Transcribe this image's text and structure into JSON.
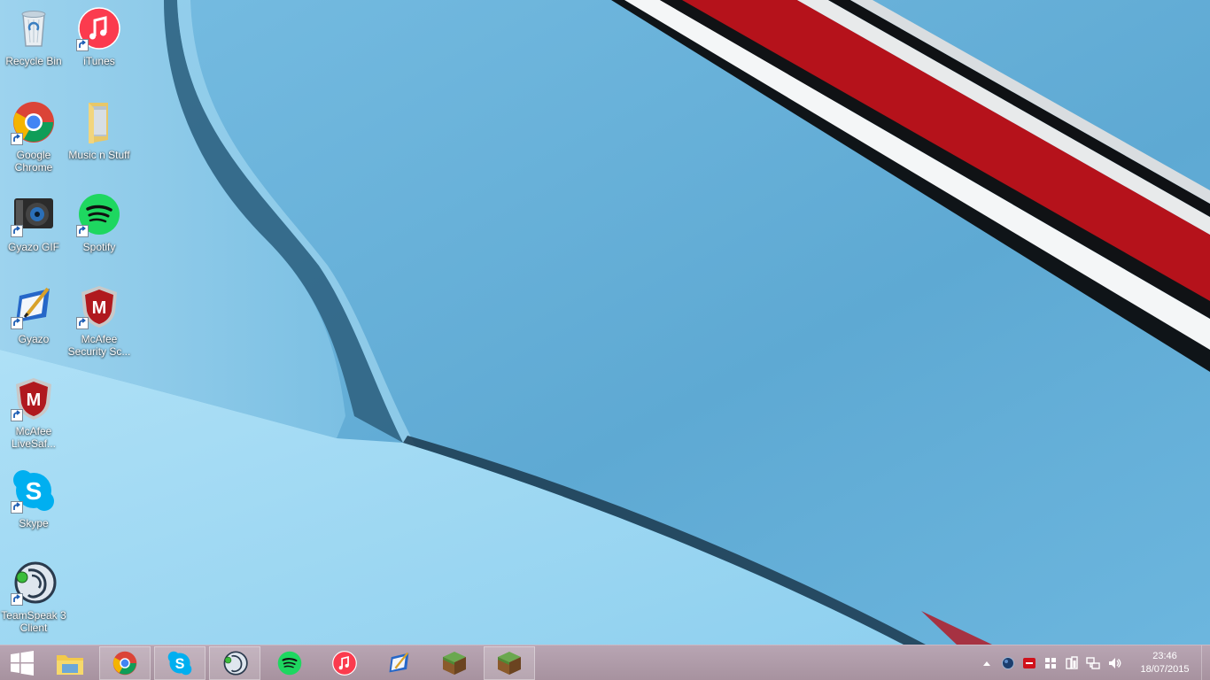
{
  "desktop_icons": [
    {
      "label": "Recycle Bin",
      "icon": "recycle-bin-icon"
    },
    {
      "label": "iTunes",
      "icon": "itunes-icon"
    },
    {
      "label": "Google Chrome",
      "icon": "chrome-icon"
    },
    {
      "label": "Music n Stuff",
      "icon": "folder-icon"
    },
    {
      "label": "Gyazo GIF",
      "icon": "gyazo-gif-icon"
    },
    {
      "label": "Spotify",
      "icon": "spotify-icon"
    },
    {
      "label": "Gyazo",
      "icon": "gyazo-icon"
    },
    {
      "label": "McAfee Security Sc...",
      "icon": "mcafee-icon"
    },
    {
      "label": "McAfee LiveSaf...",
      "icon": "mcafee-icon"
    },
    {
      "label": "Skype",
      "icon": "skype-icon"
    },
    {
      "label": "TeamSpeak 3 Client",
      "icon": "teamspeak-icon"
    }
  ],
  "taskbar": {
    "apps": [
      {
        "name": "file-explorer",
        "icon": "folder-icon"
      },
      {
        "name": "chrome",
        "icon": "chrome-icon",
        "active": true
      },
      {
        "name": "skype",
        "icon": "skype-icon",
        "active": true
      },
      {
        "name": "teamspeak",
        "icon": "teamspeak-icon",
        "active": true
      },
      {
        "name": "spotify",
        "icon": "spotify-icon"
      },
      {
        "name": "itunes",
        "icon": "itunes-icon"
      },
      {
        "name": "gyazo",
        "icon": "gyazo-icon"
      },
      {
        "name": "minecraft",
        "icon": "minecraft-icon"
      },
      {
        "name": "minecraft-running",
        "icon": "minecraft-icon",
        "active": true
      }
    ],
    "clock": {
      "time": "23:46",
      "date": "18/07/2015"
    }
  },
  "colors": {
    "taskbar": "#ab97a4",
    "wallpaper_blue": "#6ab3d8",
    "stripe_red": "#b5121b"
  }
}
